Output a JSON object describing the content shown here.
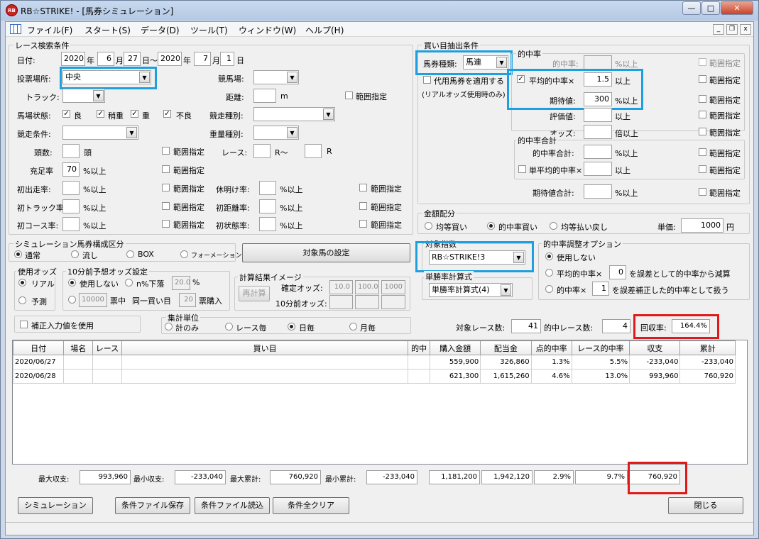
{
  "window": {
    "title": "RB☆STRIKE! - [馬券シミュレーション]",
    "icon_text": "RB",
    "min": "—",
    "max": "□",
    "close": "✕",
    "mdi_min": "_",
    "mdi_restore": "❐",
    "mdi_close": "x"
  },
  "menu": [
    "ファイル(F)",
    "スタート(S)",
    "データ(D)",
    "ツール(T)",
    "ウィンドウ(W)",
    "ヘルプ(H)"
  ],
  "race": {
    "group": "レース検索条件",
    "date_label": "日付:",
    "from_y": "2020",
    "nen1": "年",
    "from_m": "6",
    "tsuki1": "月",
    "from_d": "27",
    "hi_range": "日〜",
    "to_y": "2020",
    "nen2": "年",
    "to_m": "7",
    "tsuki2": "月",
    "to_d": "1",
    "hi2": "日",
    "venue_label": "投票場所:",
    "venue": "中央",
    "track_venue_label": "競馬場:",
    "track_label": "トラック:",
    "distance_label": "距離:",
    "m": "m",
    "range": "範囲指定",
    "condition_label": "馬場状態:",
    "c1": "良",
    "c2": "稍重",
    "c3": "重",
    "c4": "不良",
    "race_type_label": "競走種別:",
    "race_cond_label": "競走条件:",
    "weight_label": "重量種別:",
    "heads_label": "頭数:",
    "tou": "頭",
    "race_label": "レース:",
    "r1": "R〜",
    "r2": "R",
    "fill_label": "充足率",
    "fill": "70",
    "pct_above": "%以上",
    "first_run": "初出走率:",
    "rest_label": "休明け率:",
    "first_track": "初トラック率:",
    "first_dist": "初距離率:",
    "first_course": "初コース率:",
    "first_state": "初状態率:"
  },
  "sim": {
    "group": "シミュレーション馬券構成区分",
    "o1": "通常",
    "o2": "流し",
    "o3": "BOX",
    "o4": "フォーメーション",
    "target_btn": "対象馬の設定"
  },
  "odds_use": {
    "group": "使用オッズ",
    "o1": "リアル",
    "o2": "予測"
  },
  "odds10": {
    "group": "10分前予想オッズ設定",
    "o1": "使用しない",
    "o2": "n%下落",
    "pct": "20.0",
    "pct_u": "%",
    "v": "10000",
    "t1": "票中",
    "t2": "同一買い目",
    "v2": "20",
    "t3": "票購入"
  },
  "calc": {
    "group": "計算結果イメージ",
    "btn": "再計算",
    "kakutei": "確定オッズ:",
    "k1": "10.0",
    "k2": "100.0",
    "k3": "1000",
    "pre": "10分前オッズ:"
  },
  "correction": "補正入力値を使用",
  "agg": {
    "group": "集計単位",
    "o1": "計のみ",
    "o2": "レース毎",
    "o3": "日毎",
    "o4": "月毎"
  },
  "buy": {
    "group": "買い目抽出条件",
    "type_label": "馬券種類:",
    "type": "馬連",
    "subst1": "代用馬券を適用する",
    "subst2": "(リアルオッズ使用時のみ)",
    "hit_group": "的中率",
    "hit_label": "的中率:",
    "avg_hit": "平均的中率×",
    "avg_v": "1.5",
    "above": "以上",
    "exp_label": "期待値:",
    "exp_v": "300",
    "eval_label": "評価値:",
    "odds_label": "オッズ:",
    "times_above": "倍以上",
    "sum_group": "的中率合計",
    "sum_label": "的中率合計:",
    "single_avg": "単平均的中率×",
    "exp_sum": "期待値合計:",
    "range": "範囲指定",
    "pct_above": "%以上"
  },
  "money": {
    "group": "金額配分",
    "o1": "均等買い",
    "o2": "的中率買い",
    "o3": "均等払い戻し",
    "unit_label": "単価:",
    "unit": "1000",
    "yen": "円"
  },
  "index": {
    "group": "対象指数",
    "value": "RB☆STRIKE!3",
    "sub_label": "単勝率計算式",
    "sub": "単勝率計算式(4)"
  },
  "adj": {
    "group": "的中率調整オプション",
    "o1": "使用しない",
    "o2a": "平均的中率×",
    "o2v": "0",
    "o2b": "を誤差として的中率から減算",
    "o3a": "的中率×",
    "o3v": "1",
    "o3b": "を誤差補正した的中率として扱う"
  },
  "summary": {
    "races_label": "対象レース数:",
    "races": "41",
    "hits_label": "的中レース数:",
    "hits": "4",
    "recovery_label": "回収率:",
    "recovery": "164.4%"
  },
  "table": {
    "headers": [
      "日付",
      "場名",
      "レース",
      "買い目",
      "的中",
      "購入金額",
      "配当金",
      "点的中率",
      "レース的中率",
      "収支",
      "累計"
    ],
    "rows": [
      [
        "2020/06/27",
        "",
        "",
        "",
        "",
        "559,900",
        "326,860",
        "1.3%",
        "5.5%",
        "-233,040",
        "-233,040"
      ],
      [
        "2020/06/28",
        "",
        "",
        "",
        "",
        "621,300",
        "1,615,260",
        "4.6%",
        "13.0%",
        "993,960",
        "760,920"
      ]
    ]
  },
  "totals": {
    "max_label": "最大収支:",
    "max": "993,960",
    "min_label": "最小収支:",
    "min": "-233,040",
    "maxc_label": "最大累計:",
    "maxc": "760,920",
    "minc_label": "最小累計:",
    "minc": "-233,040",
    "buy": "1,181,200",
    "pay": "1,942,120",
    "hit": "2.9%",
    "race_hit": "9.7%",
    "cum": "760,920"
  },
  "buttons": {
    "simulate": "シミュレーション",
    "save": "条件ファイル保存",
    "load": "条件ファイル読込",
    "clear": "条件全クリア",
    "close": "閉じる"
  }
}
